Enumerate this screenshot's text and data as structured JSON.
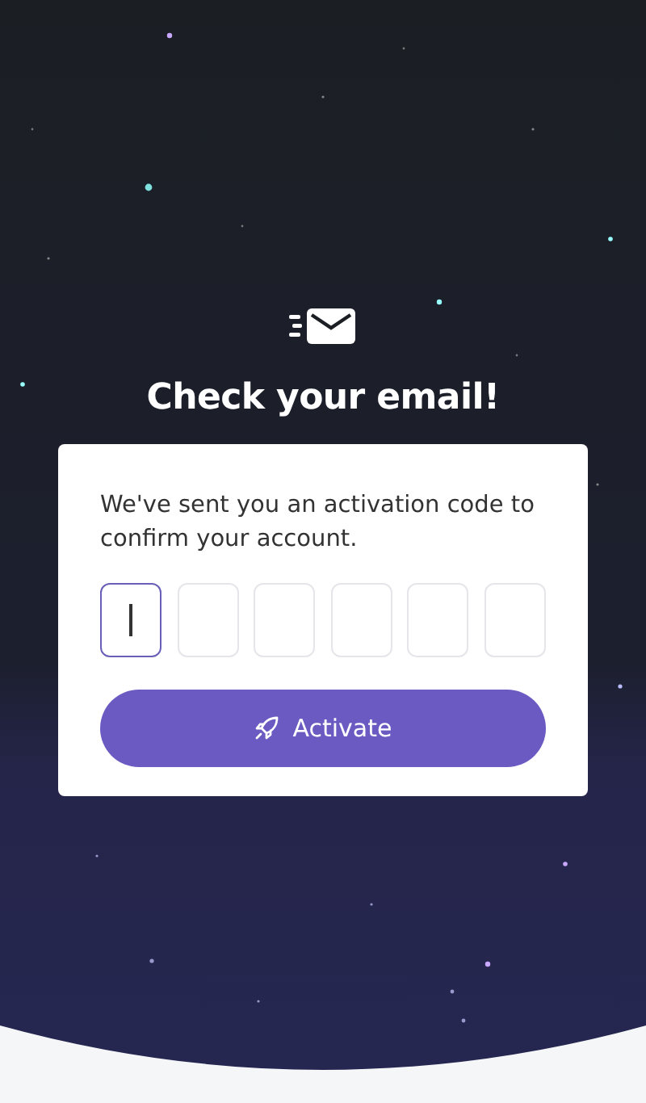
{
  "title": "Check your email!",
  "message": "We've sent you an activation code to confirm your account.",
  "code_fields": [
    {
      "focused": true
    },
    {
      "focused": false
    },
    {
      "focused": false
    },
    {
      "focused": false
    },
    {
      "focused": false
    },
    {
      "focused": false
    }
  ],
  "activate_button": {
    "label": "Activate"
  }
}
